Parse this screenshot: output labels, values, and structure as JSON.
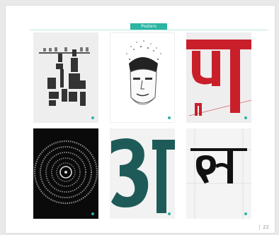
{
  "section": {
    "title": "Posters",
    "accent_color": "#2bb5a2",
    "rule_color": "#bfe8df"
  },
  "posters": [
    {
      "name": "devanagari-alphabet-letter-poster",
      "background": "#eeeeee"
    },
    {
      "name": "stippled-portrait-poster",
      "background": "#ffffff"
    },
    {
      "name": "red-ma-letter-poster",
      "background": "#eeeeee",
      "accent": "#c91f2b"
    },
    {
      "name": "om-circular-text-poster",
      "background": "#0a0a0a"
    },
    {
      "name": "teal-a-letter-poster",
      "background": "#f2f2f2",
      "accent": "#1e5b58"
    },
    {
      "name": "la-letter-construction-poster",
      "background": "#f4f4f4"
    }
  ],
  "footer": {
    "page_number": "22"
  }
}
